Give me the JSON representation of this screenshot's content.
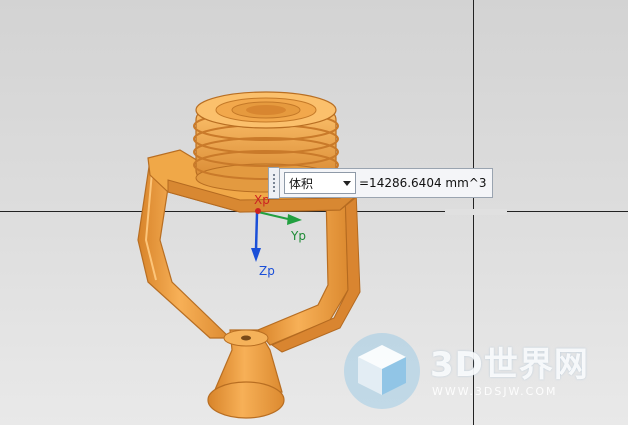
{
  "viewport": {
    "background_top": "#d3d3d3",
    "background_bottom": "#e9e9e9",
    "model_color": "#f0a040"
  },
  "measurement": {
    "property_selected": "体积",
    "result_text": "=14286.6404 mm^3"
  },
  "csys": {
    "x_label": "Xp",
    "y_label": "Yp",
    "z_label": "Zp",
    "x_color": "#cc2222",
    "y_color": "#22a040",
    "z_color": "#1a4fd8"
  },
  "watermark": {
    "logo_text": "3D世界网",
    "url_text": "WWW.3DSJW.COM",
    "logo_icon": "cube-logo-icon"
  }
}
